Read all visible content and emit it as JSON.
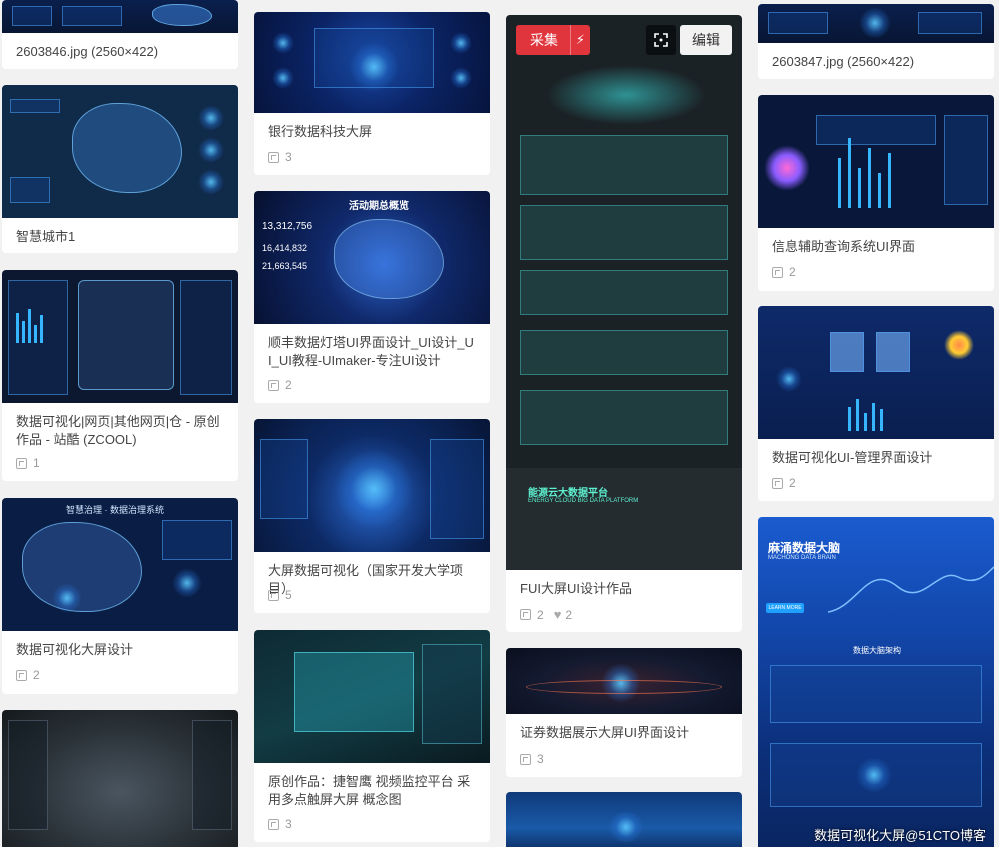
{
  "columns": [
    {
      "cards": [
        {
          "title": "2603846.jpg (2560×422)",
          "count": ""
        },
        {
          "title": "智慧城市1",
          "count": ""
        },
        {
          "title": "数据可视化|网页|其他网页|仓 - 原创作品 - 站酷 (ZCOOL)",
          "count": "1"
        },
        {
          "title": "数据可视化大屏设计",
          "count": "2"
        },
        {
          "title": "",
          "count": ""
        }
      ]
    },
    {
      "cards": [
        {
          "title": "银行数据科技大屏",
          "count": "3"
        },
        {
          "title": "顺丰数据灯塔UI界面设计_UI设计_UI_UI教程-UImaker-专注UI设计",
          "count": "2"
        },
        {
          "title": "大屏数据可视化（国家开发大学项目）",
          "count": "5"
        },
        {
          "title": "原创作品：捷智鹰 视频监控平台 采用多点触屏大屏 概念图",
          "count": "3"
        }
      ]
    },
    {
      "cards": [
        {
          "title": "FUI大屏UI设计作品",
          "count": "2",
          "likes": "2"
        },
        {
          "title": "证券数据展示大屏UI界面设计",
          "count": "3"
        },
        {
          "title": "",
          "count": ""
        }
      ]
    },
    {
      "cards": [
        {
          "title": "2603847.jpg (2560×422)",
          "count": ""
        },
        {
          "title": "信息辅助查询系统UI界面",
          "count": "2"
        },
        {
          "title": "数据可视化UI-管理界面设计",
          "count": "2"
        },
        {
          "title": "",
          "count": ""
        }
      ]
    }
  ],
  "actions": {
    "collect_label": "采集",
    "edit_label": "编辑"
  },
  "thumb_text": {
    "banner_title": "麻涌数据大脑",
    "banner_subtitle": "MACHONG DATA BRAIN",
    "banner_button": "LEARN MORE",
    "banner_section": "数据大脑架构",
    "platform_title": "能源云大数据平台",
    "platform_subtitle": "ENERGY CLOUD BIG DATA PLATFORM",
    "sf_title": "活动期总概览",
    "sf_num1": "13,312,756",
    "sf_num2": "16,414,832",
    "sf_num3": "21,663,545",
    "smart_title": "智慧治理 · 数据治理系统"
  },
  "watermark": "数据可视化大屏@51CTO博客",
  "colors": {
    "page_bg": "#f1f1f1",
    "card_bg": "#ffffff",
    "collect_red": "#e0353d",
    "title_text": "#444444",
    "meta_text": "#999999"
  }
}
